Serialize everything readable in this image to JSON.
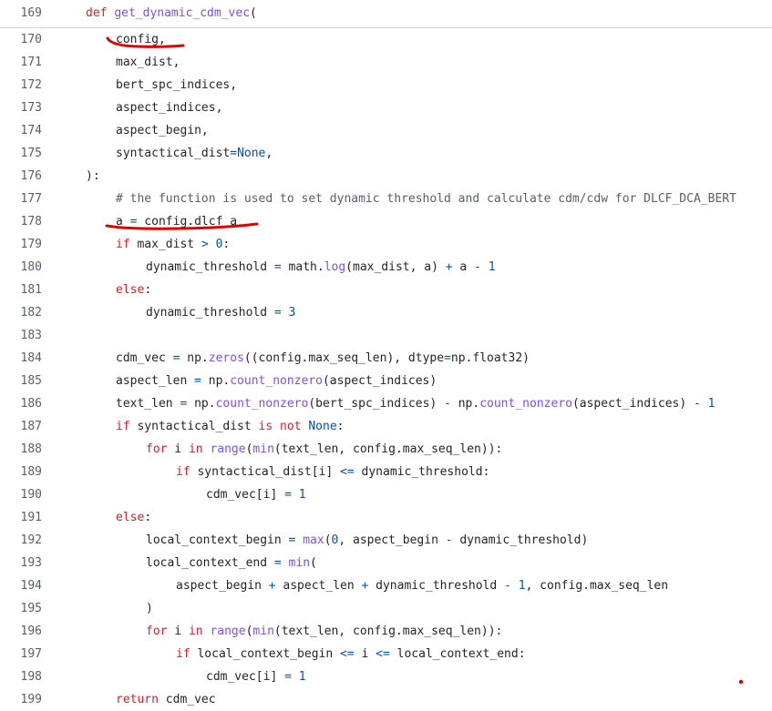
{
  "lines": [
    {
      "n": "169",
      "indent": 0,
      "tokens": [
        {
          "t": "def",
          "c": "kw"
        },
        {
          "t": " "
        },
        {
          "t": "get_dynamic_cdm_vec",
          "c": "fn"
        },
        {
          "t": "("
        }
      ]
    },
    {
      "n": "170",
      "indent": 1,
      "tokens": [
        {
          "t": "config,"
        }
      ]
    },
    {
      "n": "171",
      "indent": 1,
      "tokens": [
        {
          "t": "max_dist,"
        }
      ]
    },
    {
      "n": "172",
      "indent": 1,
      "tokens": [
        {
          "t": "bert_spc_indices,"
        }
      ]
    },
    {
      "n": "173",
      "indent": 1,
      "tokens": [
        {
          "t": "aspect_indices,"
        }
      ]
    },
    {
      "n": "174",
      "indent": 1,
      "tokens": [
        {
          "t": "aspect_begin,"
        }
      ]
    },
    {
      "n": "175",
      "indent": 1,
      "tokens": [
        {
          "t": "syntactical_dist"
        },
        {
          "t": "=",
          "c": "op"
        },
        {
          "t": "None",
          "c": "num"
        },
        {
          "t": ","
        }
      ]
    },
    {
      "n": "176",
      "indent": 0,
      "tokens": [
        {
          "t": "):"
        }
      ]
    },
    {
      "n": "177",
      "indent": 1,
      "tokens": [
        {
          "t": "# the function is used to set dynamic threshold and calculate cdm/cdw for DLCF_DCA_BERT",
          "c": "cm"
        }
      ]
    },
    {
      "n": "178",
      "indent": 1,
      "tokens": [
        {
          "t": "a "
        },
        {
          "t": "=",
          "c": "op"
        },
        {
          "t": " config.dlcf_a"
        }
      ]
    },
    {
      "n": "179",
      "indent": 1,
      "tokens": [
        {
          "t": "if",
          "c": "kw"
        },
        {
          "t": " max_dist "
        },
        {
          "t": ">",
          "c": "op"
        },
        {
          "t": " "
        },
        {
          "t": "0",
          "c": "num"
        },
        {
          "t": ":"
        }
      ]
    },
    {
      "n": "180",
      "indent": 2,
      "tokens": [
        {
          "t": "dynamic_threshold "
        },
        {
          "t": "=",
          "c": "op"
        },
        {
          "t": " math."
        },
        {
          "t": "log",
          "c": "fn"
        },
        {
          "t": "(max_dist, a) "
        },
        {
          "t": "+",
          "c": "op"
        },
        {
          "t": " a "
        },
        {
          "t": "-",
          "c": "op"
        },
        {
          "t": " "
        },
        {
          "t": "1",
          "c": "num"
        }
      ]
    },
    {
      "n": "181",
      "indent": 1,
      "tokens": [
        {
          "t": "else",
          "c": "kw"
        },
        {
          "t": ":"
        }
      ]
    },
    {
      "n": "182",
      "indent": 2,
      "tokens": [
        {
          "t": "dynamic_threshold "
        },
        {
          "t": "=",
          "c": "op"
        },
        {
          "t": " "
        },
        {
          "t": "3",
          "c": "num"
        }
      ]
    },
    {
      "n": "183",
      "indent": 0,
      "tokens": []
    },
    {
      "n": "184",
      "indent": 1,
      "tokens": [
        {
          "t": "cdm_vec "
        },
        {
          "t": "=",
          "c": "op"
        },
        {
          "t": " np."
        },
        {
          "t": "zeros",
          "c": "fn"
        },
        {
          "t": "((config.max_seq_len), dtype"
        },
        {
          "t": "=",
          "c": "op"
        },
        {
          "t": "np.float32)"
        }
      ]
    },
    {
      "n": "185",
      "indent": 1,
      "tokens": [
        {
          "t": "aspect_len "
        },
        {
          "t": "=",
          "c": "op"
        },
        {
          "t": " np."
        },
        {
          "t": "count_nonzero",
          "c": "fn"
        },
        {
          "t": "(aspect_indices)"
        }
      ]
    },
    {
      "n": "186",
      "indent": 1,
      "tokens": [
        {
          "t": "text_len "
        },
        {
          "t": "=",
          "c": "op"
        },
        {
          "t": " np."
        },
        {
          "t": "count_nonzero",
          "c": "fn"
        },
        {
          "t": "(bert_spc_indices) "
        },
        {
          "t": "-",
          "c": "op"
        },
        {
          "t": " np."
        },
        {
          "t": "count_nonzero",
          "c": "fn"
        },
        {
          "t": "(aspect_indices) "
        },
        {
          "t": "-",
          "c": "op"
        },
        {
          "t": " "
        },
        {
          "t": "1",
          "c": "num"
        }
      ]
    },
    {
      "n": "187",
      "indent": 1,
      "tokens": [
        {
          "t": "if",
          "c": "kw"
        },
        {
          "t": " syntactical_dist "
        },
        {
          "t": "is",
          "c": "kw"
        },
        {
          "t": " "
        },
        {
          "t": "not",
          "c": "kw"
        },
        {
          "t": " "
        },
        {
          "t": "None",
          "c": "num"
        },
        {
          "t": ":"
        }
      ]
    },
    {
      "n": "188",
      "indent": 2,
      "tokens": [
        {
          "t": "for",
          "c": "kw"
        },
        {
          "t": " i "
        },
        {
          "t": "in",
          "c": "kw"
        },
        {
          "t": " "
        },
        {
          "t": "range",
          "c": "fn"
        },
        {
          "t": "("
        },
        {
          "t": "min",
          "c": "fn"
        },
        {
          "t": "(text_len, config.max_seq_len)):"
        }
      ]
    },
    {
      "n": "189",
      "indent": 3,
      "tokens": [
        {
          "t": "if",
          "c": "kw"
        },
        {
          "t": " syntactical_dist[i] "
        },
        {
          "t": "<=",
          "c": "op"
        },
        {
          "t": " dynamic_threshold:"
        }
      ]
    },
    {
      "n": "190",
      "indent": 4,
      "tokens": [
        {
          "t": "cdm_vec[i] "
        },
        {
          "t": "=",
          "c": "op"
        },
        {
          "t": " "
        },
        {
          "t": "1",
          "c": "num"
        }
      ]
    },
    {
      "n": "191",
      "indent": 1,
      "tokens": [
        {
          "t": "else",
          "c": "kw"
        },
        {
          "t": ":"
        }
      ]
    },
    {
      "n": "192",
      "indent": 2,
      "tokens": [
        {
          "t": "local_context_begin "
        },
        {
          "t": "=",
          "c": "op"
        },
        {
          "t": " "
        },
        {
          "t": "max",
          "c": "fn"
        },
        {
          "t": "("
        },
        {
          "t": "0",
          "c": "num"
        },
        {
          "t": ", aspect_begin "
        },
        {
          "t": "-",
          "c": "op"
        },
        {
          "t": " dynamic_threshold)"
        }
      ]
    },
    {
      "n": "193",
      "indent": 2,
      "tokens": [
        {
          "t": "local_context_end "
        },
        {
          "t": "=",
          "c": "op"
        },
        {
          "t": " "
        },
        {
          "t": "min",
          "c": "fn"
        },
        {
          "t": "("
        }
      ]
    },
    {
      "n": "194",
      "indent": 3,
      "tokens": [
        {
          "t": "aspect_begin "
        },
        {
          "t": "+",
          "c": "op"
        },
        {
          "t": " aspect_len "
        },
        {
          "t": "+",
          "c": "op"
        },
        {
          "t": " dynamic_threshold "
        },
        {
          "t": "-",
          "c": "op"
        },
        {
          "t": " "
        },
        {
          "t": "1",
          "c": "num"
        },
        {
          "t": ", config.max_seq_len"
        }
      ]
    },
    {
      "n": "195",
      "indent": 2,
      "tokens": [
        {
          "t": ")"
        }
      ]
    },
    {
      "n": "196",
      "indent": 2,
      "tokens": [
        {
          "t": "for",
          "c": "kw"
        },
        {
          "t": " i "
        },
        {
          "t": "in",
          "c": "kw"
        },
        {
          "t": " "
        },
        {
          "t": "range",
          "c": "fn"
        },
        {
          "t": "("
        },
        {
          "t": "min",
          "c": "fn"
        },
        {
          "t": "(text_len, config.max_seq_len)):"
        }
      ]
    },
    {
      "n": "197",
      "indent": 3,
      "tokens": [
        {
          "t": "if",
          "c": "kw"
        },
        {
          "t": " local_context_begin "
        },
        {
          "t": "<=",
          "c": "op"
        },
        {
          "t": " i "
        },
        {
          "t": "<=",
          "c": "op"
        },
        {
          "t": " local_context_end:"
        }
      ]
    },
    {
      "n": "198",
      "indent": 4,
      "tokens": [
        {
          "t": "cdm_vec[i] "
        },
        {
          "t": "=",
          "c": "op"
        },
        {
          "t": " "
        },
        {
          "t": "1",
          "c": "num"
        }
      ]
    },
    {
      "n": "199",
      "indent": 1,
      "tokens": [
        {
          "t": "return",
          "c": "kw"
        },
        {
          "t": " cdm_vec"
        }
      ]
    }
  ],
  "colors": {
    "keyword": "#cf222e",
    "function": "#8250df",
    "number": "#0550ae",
    "comment": "#57606a",
    "annotation": "#e00000"
  }
}
